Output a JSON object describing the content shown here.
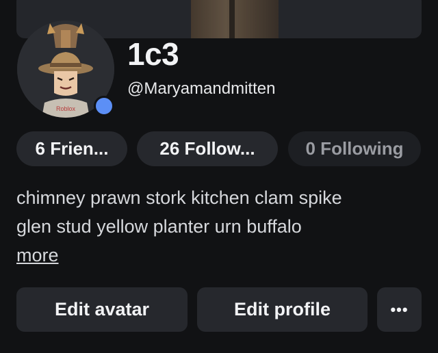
{
  "profile": {
    "display_name": "1c3",
    "username": "@Maryamandmitten",
    "online_color": "#5c8ff6"
  },
  "stats": {
    "friends_label": "6 Frien...",
    "followers_label": "26 Follow...",
    "following_label": "0 Following"
  },
  "bio": {
    "line1": "chimney prawn stork kitchen clam spike",
    "line2": "glen stud yellow planter urn buffalo",
    "more_label": "more"
  },
  "actions": {
    "edit_avatar_label": "Edit avatar",
    "edit_profile_label": "Edit profile",
    "more_label": "•••"
  },
  "avatar": {
    "shirt_text": "Roblox"
  }
}
